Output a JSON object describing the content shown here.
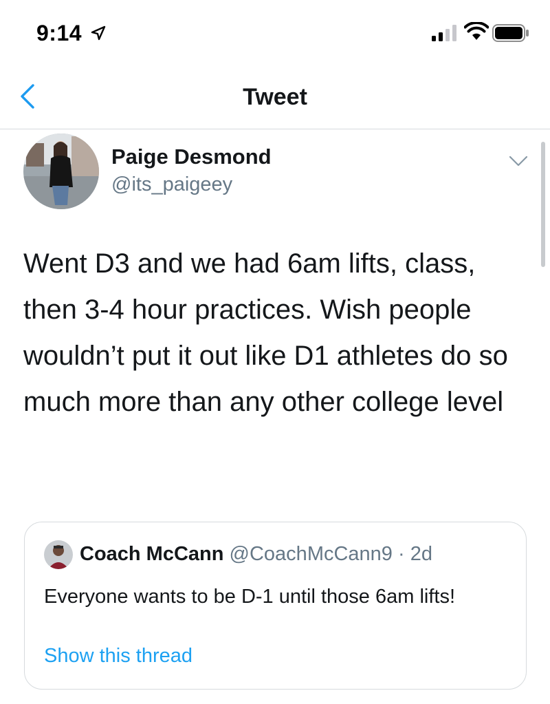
{
  "status_bar": {
    "time": "9:14",
    "icons": [
      "location-arrow-icon",
      "cellular-signal-icon",
      "wifi-icon",
      "battery-icon"
    ]
  },
  "nav": {
    "title": "Tweet",
    "back_icon": "chevron-left-icon"
  },
  "tweet": {
    "author_name": "Paige Desmond",
    "author_handle": "@its_paigeey",
    "menu_icon": "chevron-down-icon",
    "text": "Went D3 and we had 6am lifts, class, then 3-4 hour practices. Wish people wouldn’t put it out like D1 athletes do so much more than any other college level"
  },
  "quoted_tweet": {
    "author_name": "Coach McCann",
    "author_handle": "@CoachMcCann9",
    "separator": " · ",
    "time_ago": "2d",
    "text": "Everyone wants to be D-1 until those 6am lifts!",
    "show_thread_label": "Show this thread"
  },
  "colors": {
    "link_blue": "#1da1f2",
    "ios_blue": "#1d9bf0",
    "secondary_text": "#657786",
    "border": "#d6dadd"
  }
}
